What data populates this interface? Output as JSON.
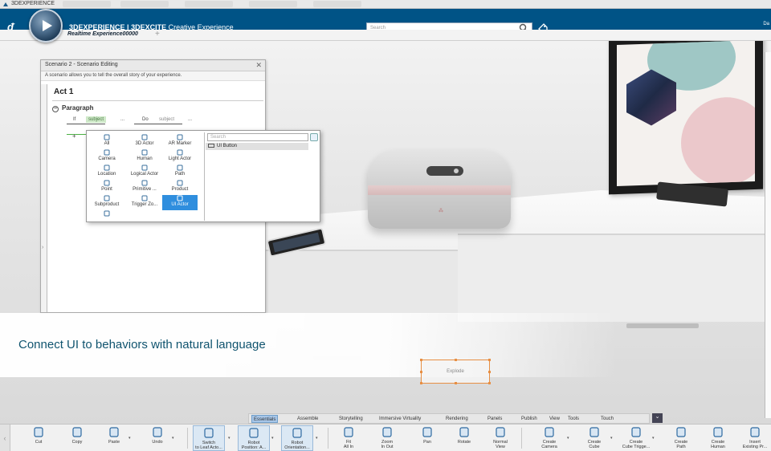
{
  "window": {
    "title": "3DEXPERIENCE"
  },
  "app": {
    "title_brand": "3DEXPERIENCE",
    "title_app": "| 3DEXCITE",
    "title_rest": "Creative Experience",
    "user": "Da"
  },
  "search": {
    "placeholder": "Search"
  },
  "tabs": [
    {
      "label": "Realtime Experience00000"
    }
  ],
  "scenario": {
    "title": "Scenario 2 - Scenario Editing",
    "description": "A scenario allows you to tell the overall story of your experience.",
    "act": "Act 1",
    "paragraph": "Paragraph",
    "if_label": "If",
    "subject_chip": "subject",
    "dots1": "...",
    "do_label": "Do",
    "subject2": "subject",
    "dots2": "...",
    "plus": "+"
  },
  "picker": {
    "search_placeholder": "Search",
    "result": "UI Button",
    "items": [
      {
        "label": "All",
        "icon": "all-icon"
      },
      {
        "label": "3D Actor",
        "icon": "3d-actor-icon"
      },
      {
        "label": "AR Marker",
        "icon": "ar-marker-icon"
      },
      {
        "label": "Camera",
        "icon": "camera-icon"
      },
      {
        "label": "Human",
        "icon": "human-icon"
      },
      {
        "label": "Light Actor",
        "icon": "light-actor-icon"
      },
      {
        "label": "Location",
        "icon": "location-icon"
      },
      {
        "label": "Logical Actor",
        "icon": "logical-actor-icon"
      },
      {
        "label": "Path",
        "icon": "path-icon"
      },
      {
        "label": "Point",
        "icon": "point-icon"
      },
      {
        "label": "Primitive ...",
        "icon": "primitive-icon"
      },
      {
        "label": "Product",
        "icon": "product-icon"
      },
      {
        "label": "Subproduct",
        "icon": "subproduct-icon"
      },
      {
        "label": "Trigger Zo...",
        "icon": "trigger-zone-icon"
      },
      {
        "label": "UI Actor",
        "icon": "ui-actor-icon",
        "selected": true
      },
      {
        "label": "",
        "icon": "misc-actor-icon"
      }
    ]
  },
  "banner": {
    "text": "Connect UI to behaviors with natural language"
  },
  "scene": {
    "explode_label": "Explode"
  },
  "toolbar_tabs": [
    "Essentials",
    "Assemble",
    "Storytelling",
    "Immersive Virtuality",
    "Rendering",
    "Panels",
    "Publish",
    "View",
    "Tools",
    "Touch"
  ],
  "active_toolbar_tab": "Essentials",
  "tools": [
    {
      "l1": "Cut",
      "l2": "",
      "icon": "cut-icon"
    },
    {
      "l1": "Copy",
      "l2": "",
      "icon": "copy-icon"
    },
    {
      "l1": "Paste",
      "l2": "",
      "icon": "paste-icon"
    },
    {
      "l1": "Undo",
      "l2": "",
      "icon": "undo-icon"
    },
    {
      "l1": "Switch",
      "l2": "to Leaf Acto...",
      "icon": "switch-leaf-icon"
    },
    {
      "l1": "Robot",
      "l2": "Position: A...",
      "icon": "robot-position-icon"
    },
    {
      "l1": "Robot",
      "l2": "Orientation...",
      "icon": "robot-orientation-icon"
    },
    {
      "l1": "Fit",
      "l2": "All In",
      "icon": "fit-all-icon"
    },
    {
      "l1": "Zoom",
      "l2": "In Out",
      "icon": "zoom-icon"
    },
    {
      "l1": "Pan",
      "l2": "",
      "icon": "pan-icon"
    },
    {
      "l1": "Rotate",
      "l2": "",
      "icon": "rotate-icon"
    },
    {
      "l1": "Normal",
      "l2": "View",
      "icon": "normal-view-icon"
    },
    {
      "l1": "Create",
      "l2": "Camera",
      "icon": "create-camera-icon"
    },
    {
      "l1": "Create",
      "l2": "Cube",
      "icon": "create-cube-icon"
    },
    {
      "l1": "Create",
      "l2": "Cube Trigge...",
      "icon": "create-cube-trigger-icon"
    },
    {
      "l1": "Create",
      "l2": "Path",
      "icon": "create-path-icon"
    },
    {
      "l1": "Create",
      "l2": "Human",
      "icon": "create-human-icon"
    },
    {
      "l1": "Insert",
      "l2": "Existing Pr...",
      "icon": "insert-existing-icon"
    }
  ]
}
